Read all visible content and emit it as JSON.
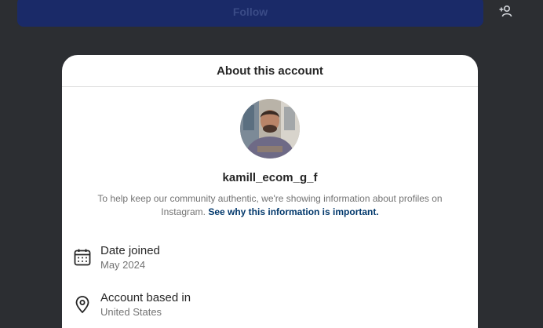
{
  "background": {
    "follow_label": "Follow",
    "follow_color": "#1a2a68"
  },
  "modal": {
    "title": "About this account",
    "username": "kamill_ecom_g_f",
    "notice_text": "To help keep our community authentic, we're showing information about profiles on Instagram. ",
    "notice_link": "See why this information is important.",
    "link_color": "#00376b",
    "details": [
      {
        "icon": "calendar-icon",
        "title": "Date joined",
        "value": "May 2024"
      },
      {
        "icon": "location-pin-icon",
        "title": "Account based in",
        "value": "United States"
      }
    ]
  }
}
